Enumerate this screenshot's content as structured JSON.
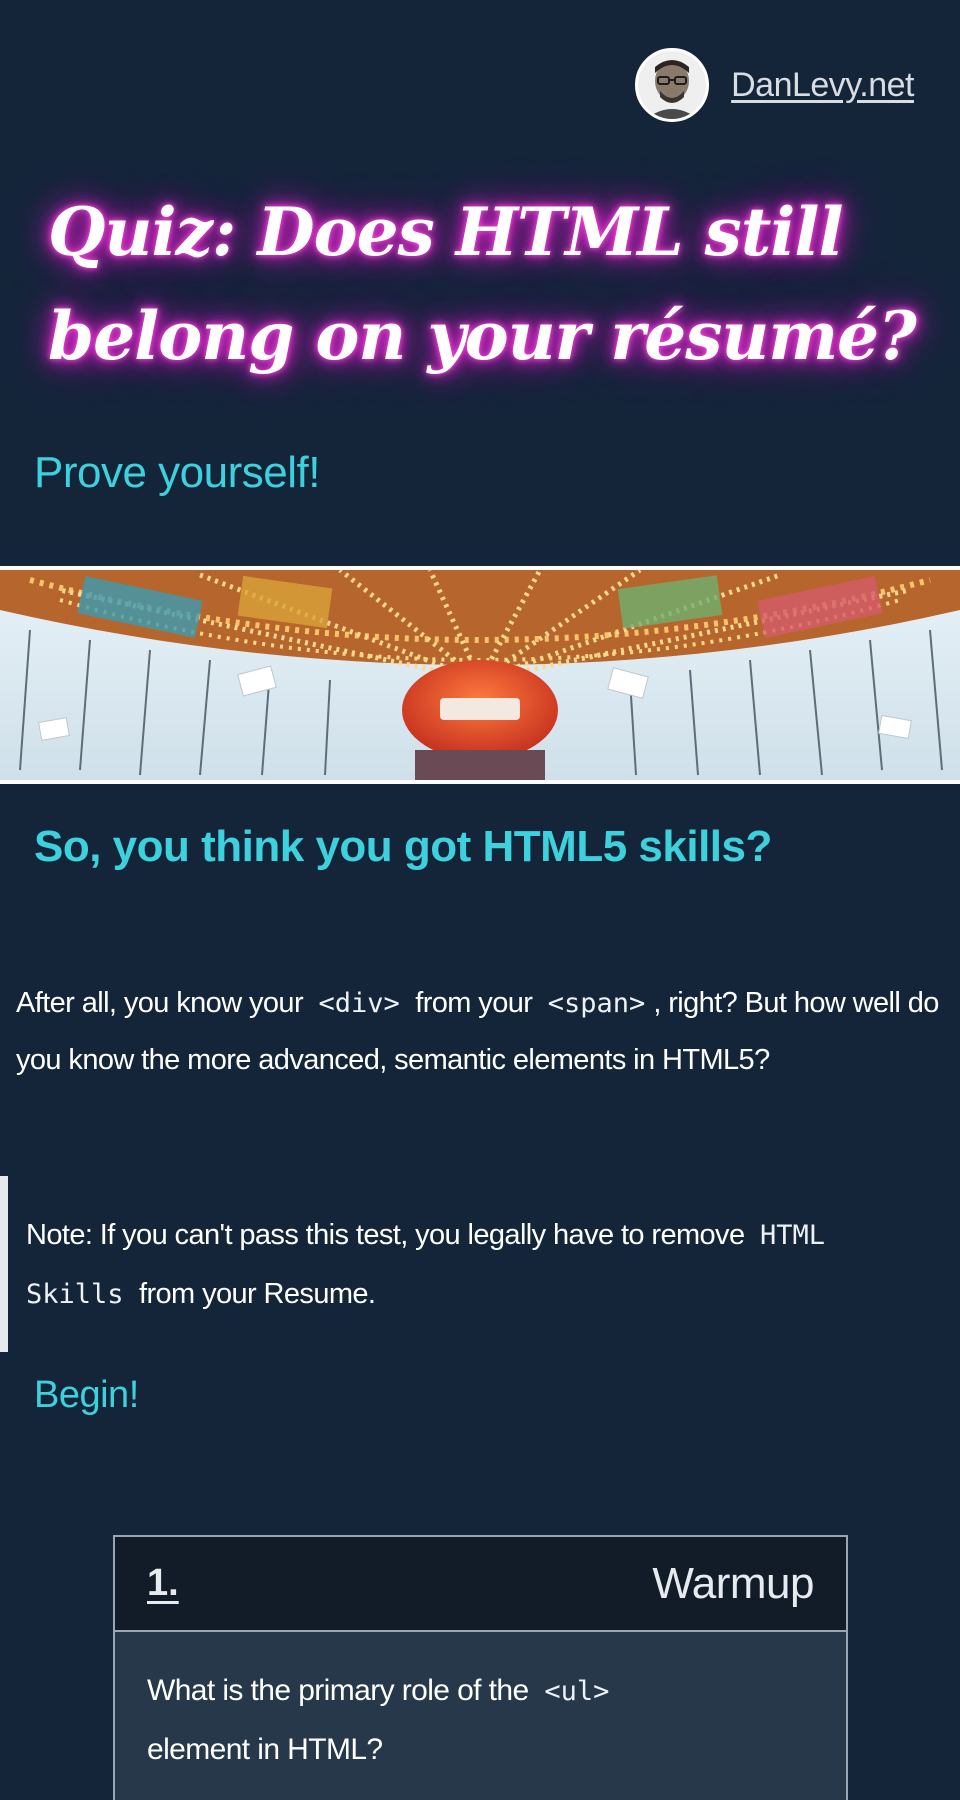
{
  "header": {
    "site_link": "DanLevy.net",
    "avatar_icon": "avatar-photo"
  },
  "hero": {
    "title": "Quiz: Does HTML still belong on your résumé?",
    "subtitle": "Prove yourself!",
    "glow_color": "#e62cd1",
    "accent_color": "#3dd0dd"
  },
  "banner": {
    "image": "carousel-swing-ride-photo"
  },
  "section": {
    "heading": "So, you think you got HTML5 skills?",
    "intro_1": "After all, you know your",
    "code_div": "<div>",
    "intro_2": "from your",
    "code_span": "<span>",
    "intro_3": ", right? But how well do you know the more advanced, semantic elements in HTML5?"
  },
  "note": {
    "text_1": "Note: If you can't pass this test, you legally have to remove",
    "code": "HTML Skills",
    "text_2": "from your Resume."
  },
  "begin_label": "Begin!",
  "quiz": {
    "number": "1.",
    "category": "Warmup",
    "question_1": "What is the primary role of the",
    "code": "<ul>",
    "question_2": "element in HTML?"
  }
}
